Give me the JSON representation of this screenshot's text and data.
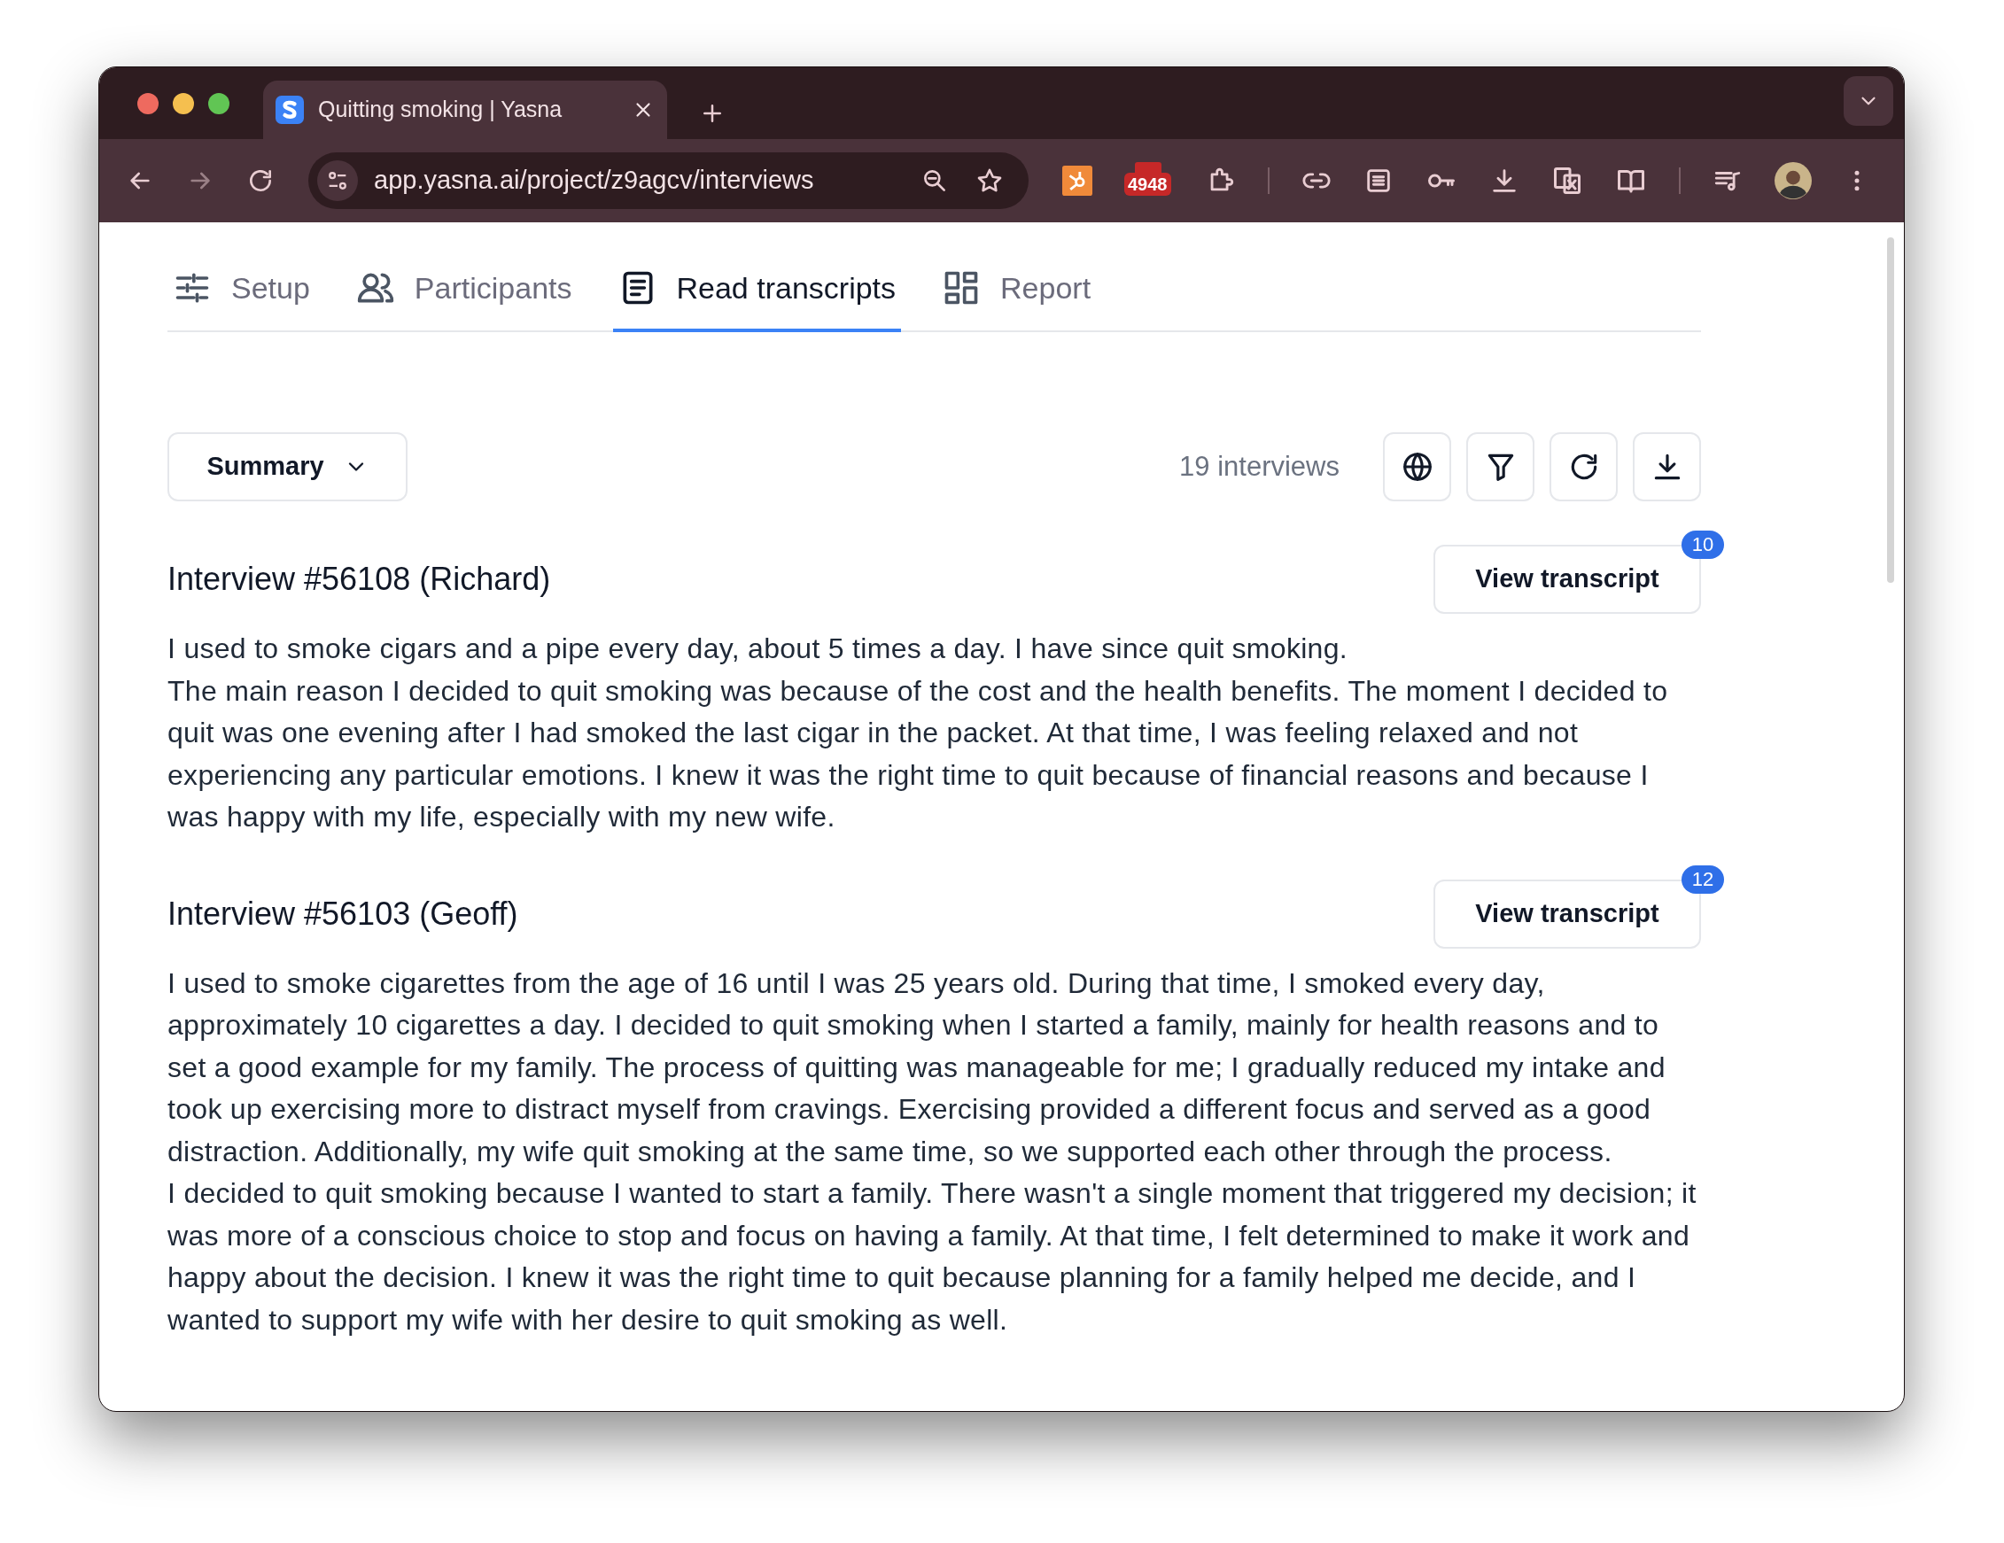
{
  "browser": {
    "tab": {
      "title": "Quitting smoking | Yasna"
    },
    "url": "app.yasna.ai/project/z9agcv/interviews",
    "extension_badge": "4948"
  },
  "nav_tabs": [
    {
      "label": "Setup",
      "selected": false
    },
    {
      "label": "Participants",
      "selected": false
    },
    {
      "label": "Read transcripts",
      "selected": true
    },
    {
      "label": "Report",
      "selected": false
    }
  ],
  "toolbar": {
    "view_select": "Summary",
    "count": "19 interviews"
  },
  "interviews": [
    {
      "title": "Interview #56108 (Richard)",
      "button": "View transcript",
      "badge": "10",
      "paragraphs": [
        "I used to smoke cigars and a pipe every day, about 5 times a day. I have since quit smoking.",
        "The main reason I decided to quit smoking was because of the cost and the health benefits. The moment I decided to quit was one evening after I had smoked the last cigar in the packet. At that time, I was feeling relaxed and not experiencing any particular emotions. I knew it was the right time to quit because of financial reasons and because I was happy with my life, especially with my new wife."
      ]
    },
    {
      "title": "Interview #56103 (Geoff)",
      "button": "View transcript",
      "badge": "12",
      "paragraphs": [
        "I used to smoke cigarettes from the age of 16 until I was 25 years old. During that time, I smoked every day, approximately 10 cigarettes a day. I decided to quit smoking when I started a family, mainly for health reasons and to set a good example for my family. The process of quitting was manageable for me; I gradually reduced my intake and took up exercising more to distract myself from cravings. Exercising provided a different focus and served as a good distraction. Additionally, my wife quit smoking at the same time, so we supported each other through the process.",
        "I decided to quit smoking because I wanted to start a family. There wasn't a single moment that triggered my decision; it was more of a conscious choice to stop and focus on having a family. At that time, I felt determined to make it work and happy about the decision. I knew it was the right time to quit because planning for a family helped me decide, and I wanted to support my wife with her desire to quit smoking as well."
      ]
    }
  ]
}
